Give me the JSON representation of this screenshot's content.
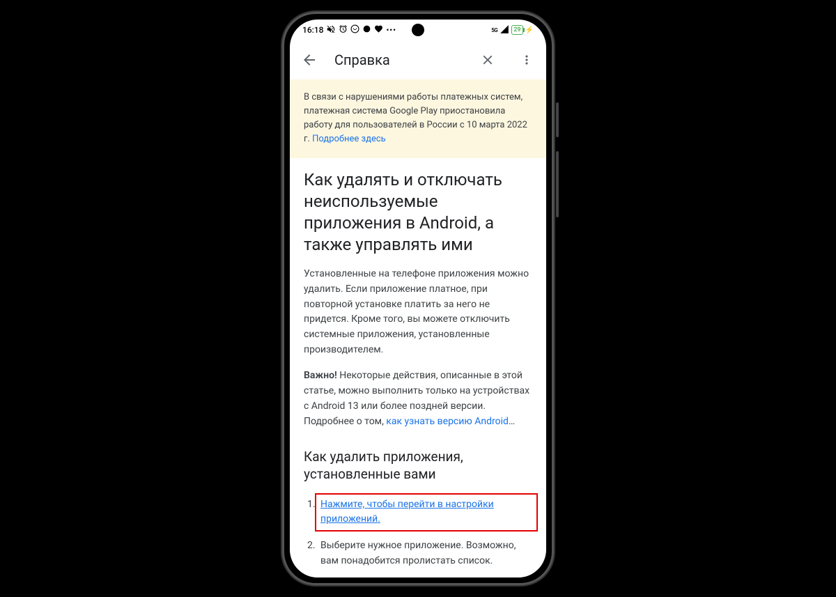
{
  "status": {
    "time": "16:18",
    "battery": "29",
    "network": "5G"
  },
  "appbar": {
    "title": "Справка"
  },
  "notice": {
    "text": "В связи с нарушениями работы платежных систем, платежная система Google Play приостановила работу для пользователей в России с 10 марта 2022 г. ",
    "link": "Подробнее здесь"
  },
  "article": {
    "title": "Как удалять и отключать неиспользуемые приложения в Android, а также управлять ими",
    "para1": "Установленные на телефоне приложения можно удалить. Если приложение платное, при повторной установке платить за него не придется. Кроме того, вы можете отключить системные приложения, установленные производителем.",
    "important_label": "Важно!",
    "para2_a": " Некоторые действия, описанные в этой статье, можно выполнить только на устройствах с Android 13 или более поздней версии. Подробнее о том, ",
    "para2_link": "как узнать версию Android",
    "para2_b": "…",
    "section1_title": "Как удалить приложения, установленные вами",
    "step1": "Нажмите, чтобы перейти в настройки приложений.",
    "step2": "Выберите нужное приложение. Возможно, вам понадобится пролистать список."
  }
}
